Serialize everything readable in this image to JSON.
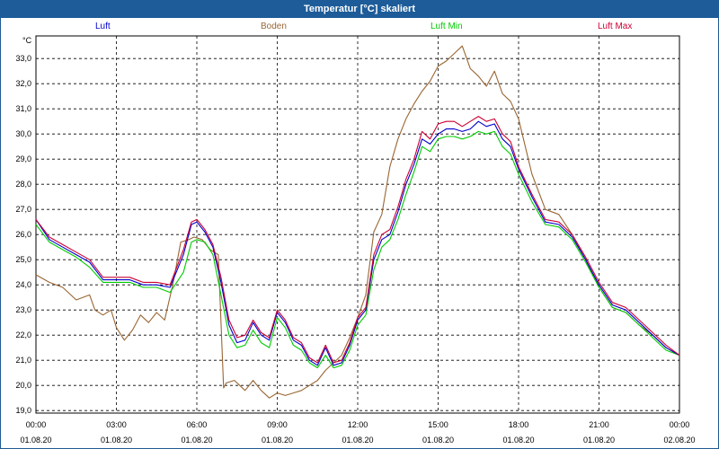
{
  "window": {
    "title": "Temperatur [°C] skaliert"
  },
  "chart_data": {
    "type": "line",
    "title": "Temperatur [°C] skaliert",
    "ylabel": "°C",
    "xlabel": "",
    "ylim": [
      18.9,
      33.9
    ],
    "xlim": [
      0,
      24
    ],
    "grid": true,
    "legend_position": "top",
    "y_ticks": [
      "19,0",
      "20,0",
      "21,0",
      "22,0",
      "23,0",
      "24,0",
      "25,0",
      "26,0",
      "27,0",
      "28,0",
      "29,0",
      "30,0",
      "31,0",
      "32,0",
      "33,0"
    ],
    "x_tick_times": [
      "00:00",
      "03:00",
      "06:00",
      "09:00",
      "12:00",
      "15:00",
      "18:00",
      "21:00",
      "00:00"
    ],
    "x_tick_dates": [
      "01.08.20",
      "01.08.20",
      "01.08.20",
      "01.08.20",
      "01.08.20",
      "01.08.20",
      "01.08.20",
      "01.08.20",
      "02.08.20"
    ],
    "series": [
      {
        "name": "Luft",
        "color": "#0000cc",
        "x": [
          0,
          0.5,
          1,
          1.5,
          2,
          2.5,
          3,
          3.5,
          4,
          4.5,
          5,
          5.5,
          5.8,
          6,
          6.3,
          6.6,
          6.9,
          7.2,
          7.5,
          7.8,
          8.1,
          8.4,
          8.7,
          9,
          9.3,
          9.6,
          9.9,
          10.2,
          10.5,
          10.8,
          11.1,
          11.4,
          11.7,
          12,
          12.3,
          12.6,
          12.9,
          13.2,
          13.5,
          13.8,
          14.1,
          14.4,
          14.7,
          15,
          15.3,
          15.6,
          15.9,
          16.2,
          16.5,
          16.8,
          17.1,
          17.4,
          17.7,
          18,
          18.5,
          19,
          19.5,
          20,
          20.5,
          21,
          21.5,
          22,
          22.5,
          23,
          23.5,
          24
        ],
        "y": [
          26.6,
          25.8,
          25.5,
          25.2,
          24.9,
          24.2,
          24.2,
          24.2,
          24.0,
          24.0,
          23.9,
          25.2,
          26.4,
          26.5,
          26.1,
          25.5,
          24.1,
          22.4,
          21.7,
          21.8,
          22.5,
          22.0,
          21.8,
          22.9,
          22.5,
          21.8,
          21.6,
          21.0,
          20.8,
          21.5,
          20.8,
          20.9,
          21.6,
          22.6,
          23.0,
          25.0,
          25.8,
          26.0,
          26.9,
          28.0,
          28.8,
          29.8,
          29.6,
          30.0,
          30.2,
          30.2,
          30.1,
          30.2,
          30.5,
          30.3,
          30.4,
          29.8,
          29.5,
          28.6,
          27.5,
          26.5,
          26.4,
          25.9,
          25.0,
          24.0,
          23.2,
          23.0,
          22.5,
          22.0,
          21.5,
          21.2
        ]
      },
      {
        "name": "Boden",
        "color": "#996633",
        "x": [
          0,
          0.5,
          1,
          1.5,
          2,
          2.2,
          2.5,
          2.8,
          3,
          3.3,
          3.6,
          3.9,
          4.2,
          4.5,
          4.8,
          5.1,
          5.4,
          5.7,
          5.9,
          6.2,
          6.5,
          6.8,
          7.0,
          7.1,
          7.4,
          7.8,
          8.1,
          8.4,
          8.7,
          9,
          9.3,
          9.6,
          9.9,
          10.2,
          10.5,
          10.8,
          11.1,
          11.4,
          11.7,
          12,
          12.3,
          12.6,
          12.9,
          13.2,
          13.5,
          13.8,
          14.1,
          14.4,
          14.7,
          15,
          15.3,
          15.6,
          15.9,
          16.2,
          16.5,
          16.8,
          17.1,
          17.4,
          17.7,
          18,
          18.5,
          19,
          19.5,
          20,
          20.5,
          21,
          21.5,
          22,
          22.5,
          23,
          23.5,
          24
        ],
        "y": [
          24.4,
          24.1,
          23.9,
          23.4,
          23.6,
          23.0,
          22.8,
          23.0,
          22.3,
          21.8,
          22.2,
          22.8,
          22.5,
          22.9,
          22.6,
          24.0,
          25.7,
          25.8,
          25.9,
          25.8,
          25.4,
          25.2,
          19.9,
          20.1,
          20.2,
          19.8,
          20.2,
          19.8,
          19.5,
          19.7,
          19.6,
          19.7,
          19.8,
          20.0,
          20.2,
          20.6,
          20.9,
          21.2,
          21.9,
          22.7,
          23.6,
          26.1,
          26.8,
          28.7,
          29.8,
          30.6,
          31.2,
          31.7,
          32.1,
          32.7,
          32.9,
          33.2,
          33.5,
          32.6,
          32.3,
          31.9,
          32.5,
          31.6,
          31.3,
          30.6,
          28.4,
          27.0,
          26.8,
          26.0,
          25.0,
          23.9,
          23.1,
          22.9,
          22.4,
          22.0,
          21.5,
          21.2
        ]
      },
      {
        "name": "Luft Min",
        "color": "#00cc00",
        "x": [
          0,
          0.5,
          1,
          1.5,
          2,
          2.5,
          3,
          3.5,
          4,
          4.5,
          5,
          5.5,
          5.8,
          6,
          6.3,
          6.6,
          6.9,
          7.2,
          7.5,
          7.8,
          8.1,
          8.4,
          8.7,
          9,
          9.3,
          9.6,
          9.9,
          10.2,
          10.5,
          10.8,
          11.1,
          11.4,
          11.7,
          12,
          12.3,
          12.6,
          12.9,
          13.2,
          13.5,
          13.8,
          14.1,
          14.4,
          14.7,
          15,
          15.3,
          15.6,
          15.9,
          16.2,
          16.5,
          16.8,
          17.1,
          17.4,
          17.7,
          18,
          18.5,
          19,
          19.5,
          20,
          20.5,
          21,
          21.5,
          22,
          22.5,
          23,
          23.5,
          24
        ],
        "y": [
          26.4,
          25.7,
          25.4,
          25.1,
          24.7,
          24.1,
          24.1,
          24.1,
          23.9,
          23.9,
          23.7,
          24.5,
          25.7,
          25.8,
          25.7,
          25.2,
          23.6,
          22.0,
          21.5,
          21.6,
          22.2,
          21.7,
          21.5,
          22.7,
          22.3,
          21.6,
          21.4,
          20.9,
          20.7,
          21.2,
          20.7,
          20.8,
          21.4,
          22.4,
          22.8,
          24.6,
          25.5,
          25.8,
          26.6,
          27.6,
          28.5,
          29.5,
          29.3,
          29.8,
          29.9,
          29.9,
          29.8,
          29.9,
          30.1,
          30.0,
          30.1,
          29.5,
          29.2,
          28.4,
          27.3,
          26.4,
          26.3,
          25.8,
          24.9,
          23.9,
          23.1,
          22.9,
          22.4,
          21.9,
          21.4,
          21.2
        ]
      },
      {
        "name": "Luft Max",
        "color": "#cc0033",
        "x": [
          0,
          0.5,
          1,
          1.5,
          2,
          2.5,
          3,
          3.5,
          4,
          4.5,
          5,
          5.5,
          5.8,
          6,
          6.3,
          6.6,
          6.9,
          7.2,
          7.5,
          7.8,
          8.1,
          8.4,
          8.7,
          9,
          9.3,
          9.6,
          9.9,
          10.2,
          10.5,
          10.8,
          11.1,
          11.4,
          11.7,
          12,
          12.3,
          12.6,
          12.9,
          13.2,
          13.5,
          13.8,
          14.1,
          14.4,
          14.7,
          15,
          15.3,
          15.6,
          15.9,
          16.2,
          16.5,
          16.8,
          17.1,
          17.4,
          17.7,
          18,
          18.5,
          19,
          19.5,
          20,
          20.5,
          21,
          21.5,
          22,
          22.5,
          23,
          23.5,
          24
        ],
        "y": [
          26.6,
          25.9,
          25.6,
          25.3,
          25.0,
          24.3,
          24.3,
          24.3,
          24.1,
          24.1,
          24.0,
          25.4,
          26.5,
          26.6,
          26.2,
          25.6,
          24.3,
          22.6,
          21.9,
          22.0,
          22.6,
          22.1,
          21.9,
          23.0,
          22.6,
          21.9,
          21.7,
          21.1,
          20.9,
          21.6,
          20.9,
          21.0,
          21.7,
          22.7,
          23.1,
          25.2,
          26.0,
          26.2,
          27.1,
          28.2,
          29.0,
          30.1,
          29.8,
          30.4,
          30.5,
          30.5,
          30.3,
          30.5,
          30.7,
          30.5,
          30.6,
          30.0,
          29.7,
          28.7,
          27.6,
          26.6,
          26.5,
          26.0,
          25.1,
          24.1,
          23.3,
          23.1,
          22.6,
          22.1,
          21.6,
          21.2
        ]
      }
    ]
  }
}
